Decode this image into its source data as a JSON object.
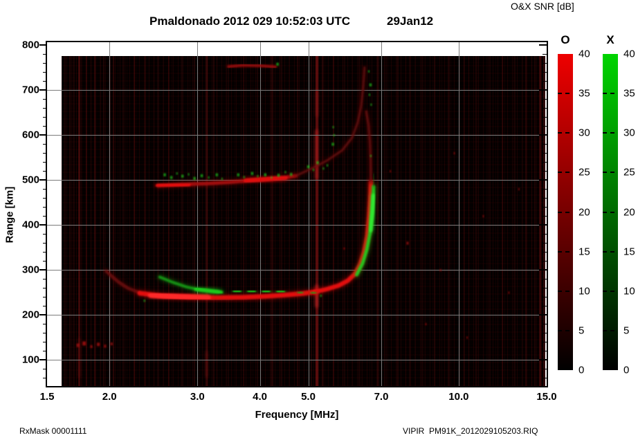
{
  "title": {
    "main": "Pmaldonado 2012 029 10:52:03 UTC",
    "date": "29Jan12"
  },
  "colorbar": {
    "header": "O&X SNR [dB]",
    "bars": [
      {
        "name": "O",
        "top_color": "#ee0000",
        "bottom_color": "#000000"
      },
      {
        "name": "X",
        "top_color": "#00d400",
        "bottom_color": "#000000"
      }
    ],
    "ticks": [
      "40",
      "35",
      "30",
      "25",
      "20",
      "15",
      "10",
      "5",
      "0"
    ],
    "min": 0,
    "max": 40,
    "units": "dB"
  },
  "axes": {
    "x": {
      "label": "Frequency [MHz]",
      "scale": "log",
      "min": 1.5,
      "max": 15,
      "tick_values": [
        1.5,
        2,
        3,
        4,
        5,
        7,
        10,
        15
      ],
      "tick_labels": [
        "1.5",
        "2.0",
        "3.0",
        "4.0",
        "5.0",
        "7.0",
        "10.0",
        "15.0"
      ]
    },
    "y": {
      "label": "Range [km]",
      "scale": "linear",
      "min": 42,
      "max": 806,
      "tick_values": [
        100,
        200,
        300,
        400,
        500,
        600,
        700,
        800
      ],
      "tick_labels": [
        "100",
        "200",
        "300",
        "400",
        "500",
        "600",
        "700",
        "800"
      ],
      "minor_step": 20
    }
  },
  "grid": {
    "x_lines": [
      2,
      3,
      4,
      5,
      7,
      10
    ],
    "y_lines": [
      100,
      200,
      300,
      400,
      500,
      600,
      700
    ],
    "color": "#7b7b7b"
  },
  "footer": {
    "left": "RxMask 00001111",
    "right": "VIPIR  PM91K_2012029105203.RIQ"
  },
  "chart_data": {
    "type": "heatmap",
    "description": "VIPIR ionogram: O-mode (red) and X-mode (green) echo SNR vs frequency and virtual range",
    "station": "Pmaldonado",
    "time_utc": "2012 029 10:52:03 UTC",
    "date": "29Jan12",
    "xlabel": "Frequency [MHz]",
    "ylabel": "Range [km]",
    "xlim": [
      1.5,
      15
    ],
    "ylim": [
      42,
      806
    ],
    "snr_scale_db": [
      0,
      40
    ],
    "data_extent": {
      "f_min": 1.6,
      "f_max": 14.95,
      "r_min": 42,
      "r_max": 775
    },
    "colors": {
      "O": {
        "dim": "#6e0808",
        "mid": "#a80d0d",
        "bright": "#e41111",
        "hot": "#ff2a2a"
      },
      "X": {
        "dim": "#0c6e0c",
        "mid": "#13a013",
        "bright": "#1ecd1e",
        "hot": "#33e833"
      }
    },
    "traces": [
      {
        "name": "o1-left-tail",
        "mode": "O",
        "lvl": "dim",
        "w": 4.5,
        "op": 0.85,
        "pts": [
          [
            1.97,
            297
          ],
          [
            2.02,
            286
          ],
          [
            2.09,
            272
          ],
          [
            2.18,
            259
          ],
          [
            2.3,
            249
          ]
        ]
      },
      {
        "name": "o1-flat",
        "mode": "O",
        "lvl": "bright",
        "w": 6.5,
        "op": 1,
        "pts": [
          [
            2.3,
            248
          ],
          [
            2.55,
            242
          ],
          [
            2.9,
            239
          ],
          [
            3.3,
            238
          ],
          [
            3.7,
            239
          ],
          [
            4.1,
            241
          ],
          [
            4.5,
            244
          ],
          [
            4.85,
            247
          ],
          [
            5.15,
            251
          ]
        ]
      },
      {
        "name": "o1-core",
        "mode": "O",
        "lvl": "hot",
        "w": 8,
        "op": 0.95,
        "pts": [
          [
            2.42,
            244
          ],
          [
            2.75,
            240
          ],
          [
            3.15,
            238
          ]
        ]
      },
      {
        "name": "o1-rise",
        "mode": "O",
        "lvl": "bright",
        "w": 6,
        "op": 1,
        "pts": [
          [
            5.15,
            251
          ],
          [
            5.45,
            257
          ],
          [
            5.75,
            265
          ],
          [
            6.0,
            276
          ],
          [
            6.2,
            291
          ],
          [
            6.35,
            312
          ],
          [
            6.47,
            340
          ],
          [
            6.56,
            375
          ],
          [
            6.62,
            420
          ],
          [
            6.655,
            462
          ],
          [
            6.67,
            495
          ]
        ]
      },
      {
        "name": "o1-asymptote",
        "mode": "O",
        "lvl": "dim",
        "w": 3.5,
        "op": 0.8,
        "pts": [
          [
            6.67,
            495
          ],
          [
            6.665,
            540
          ],
          [
            6.64,
            585
          ],
          [
            6.6,
            622
          ],
          [
            6.53,
            652
          ]
        ]
      },
      {
        "name": "o2-flat",
        "mode": "O",
        "lvl": "mid",
        "w": 5,
        "op": 0.95,
        "pts": [
          [
            2.5,
            487
          ],
          [
            2.8,
            490
          ],
          [
            3.15,
            492
          ],
          [
            3.5,
            495
          ],
          [
            3.85,
            499
          ],
          [
            4.2,
            502
          ],
          [
            4.55,
            506
          ],
          [
            4.72,
            509
          ]
        ]
      },
      {
        "name": "o2-left-bright",
        "mode": "O",
        "lvl": "bright",
        "w": 6,
        "op": 0.9,
        "pts": [
          [
            2.5,
            487
          ],
          [
            2.88,
            490
          ]
        ]
      },
      {
        "name": "o2-right-bright",
        "mode": "O",
        "lvl": "bright",
        "w": 6,
        "op": 0.9,
        "pts": [
          [
            3.75,
            498
          ],
          [
            4.5,
            505
          ]
        ]
      },
      {
        "name": "o2-cusp",
        "mode": "O",
        "lvl": "dim",
        "w": 3,
        "op": 0.8,
        "pts": [
          [
            4.72,
            509
          ],
          [
            5.05,
            524
          ],
          [
            5.45,
            543
          ],
          [
            5.85,
            566
          ],
          [
            6.12,
            594
          ],
          [
            6.28,
            628
          ],
          [
            6.38,
            664
          ],
          [
            6.44,
            706
          ],
          [
            6.48,
            750
          ]
        ]
      },
      {
        "name": "o3-top-streak",
        "mode": "O",
        "lvl": "mid",
        "w": 3.5,
        "op": 0.85,
        "pts": [
          [
            3.46,
            752
          ],
          [
            3.7,
            755
          ],
          [
            4.0,
            754
          ],
          [
            4.3,
            751
          ]
        ]
      },
      {
        "name": "x1-descent",
        "mode": "X",
        "lvl": "mid",
        "w": 4,
        "op": 0.9,
        "pts": [
          [
            2.52,
            284
          ],
          [
            2.68,
            272
          ],
          [
            2.85,
            262
          ],
          [
            3.05,
            255
          ],
          [
            3.3,
            251
          ]
        ]
      },
      {
        "name": "x1-bright",
        "mode": "X",
        "lvl": "bright",
        "w": 5,
        "op": 0.95,
        "pts": [
          [
            2.98,
            257
          ],
          [
            3.35,
            250
          ]
        ]
      },
      {
        "name": "x1-flat",
        "mode": "X",
        "lvl": "bright",
        "w": 3.5,
        "op": 0.9,
        "dash": "9 12",
        "pts": [
          [
            3.55,
            253
          ],
          [
            4.6,
            251
          ]
        ]
      },
      {
        "name": "x1-sparse",
        "mode": "X",
        "lvl": "mid",
        "w": 3,
        "op": 0.8,
        "dash": "5 14",
        "pts": [
          [
            4.78,
            250
          ],
          [
            5.2,
            248
          ]
        ]
      },
      {
        "name": "x1-rise",
        "mode": "X",
        "lvl": "bright",
        "w": 4.5,
        "op": 0.95,
        "pts": [
          [
            6.25,
            289
          ],
          [
            6.42,
            314
          ],
          [
            6.55,
            345
          ],
          [
            6.65,
            382
          ],
          [
            6.71,
            424
          ],
          [
            6.745,
            460
          ],
          [
            6.755,
            485
          ]
        ]
      },
      {
        "name": "x1-rise-hot",
        "mode": "X",
        "lvl": "hot",
        "w": 5.5,
        "op": 0.95,
        "pts": [
          [
            6.66,
            388
          ],
          [
            6.72,
            430
          ],
          [
            6.75,
            465
          ]
        ]
      },
      {
        "name": "x1-rise-tail",
        "mode": "X",
        "lvl": "dim",
        "w": 3,
        "op": 0.7,
        "pts": [
          [
            6.755,
            485
          ],
          [
            6.76,
            512
          ]
        ]
      }
    ],
    "speckles_x_mode": [
      [
        2.58,
        512,
        3
      ],
      [
        2.66,
        506,
        3
      ],
      [
        2.73,
        515,
        2
      ],
      [
        2.8,
        509,
        3
      ],
      [
        2.88,
        513,
        2
      ],
      [
        2.96,
        504,
        3
      ],
      [
        3.06,
        510,
        3
      ],
      [
        3.16,
        506,
        2
      ],
      [
        3.28,
        512,
        3
      ],
      [
        3.36,
        503,
        2
      ],
      [
        3.62,
        512,
        3
      ],
      [
        3.72,
        507,
        2
      ],
      [
        3.86,
        515,
        3
      ],
      [
        3.96,
        509,
        2
      ],
      [
        4.1,
        512,
        3
      ],
      [
        4.22,
        506,
        2
      ],
      [
        4.36,
        511,
        3
      ],
      [
        4.5,
        518,
        2
      ],
      [
        4.62,
        513,
        3
      ],
      [
        5.0,
        530,
        3
      ],
      [
        5.12,
        523,
        2
      ],
      [
        5.22,
        539,
        3
      ],
      [
        5.36,
        526,
        2
      ],
      [
        5.46,
        533,
        2
      ],
      [
        5.6,
        580,
        3
      ],
      [
        5.63,
        600,
        2
      ],
      [
        5.61,
        618,
        2
      ],
      [
        6.63,
        690,
        2
      ],
      [
        6.66,
        712,
        3
      ],
      [
        6.61,
        742,
        2
      ],
      [
        6.68,
        668,
        2
      ],
      [
        6.67,
        554,
        2
      ],
      [
        4.34,
        758,
        3
      ],
      [
        2.35,
        232,
        2
      ],
      [
        5.3,
        243,
        2
      ]
    ],
    "speckles_o_mode": [
      [
        1.73,
        133,
        4
      ],
      [
        1.78,
        137,
        5
      ],
      [
        1.84,
        130,
        3
      ],
      [
        1.9,
        135,
        4
      ],
      [
        1.96,
        131,
        3
      ],
      [
        2.02,
        136,
        3
      ],
      [
        7.9,
        360,
        3
      ],
      [
        9.2,
        300,
        2
      ],
      [
        11.2,
        420,
        2
      ],
      [
        8.6,
        180,
        2
      ],
      [
        12.6,
        250,
        2
      ],
      [
        10.4,
        150,
        2
      ],
      [
        13.2,
        480,
        2
      ],
      [
        7.3,
        520,
        2
      ],
      [
        9.8,
        560,
        2
      ],
      [
        5.9,
        348,
        2
      ]
    ],
    "rfi_columns": [
      [
        1.63,
        0.1,
        2
      ],
      [
        1.665,
        0.13,
        2
      ],
      [
        1.7,
        0.1,
        2
      ],
      [
        1.74,
        0.28,
        3
      ],
      [
        1.8,
        0.15,
        2
      ],
      [
        1.87,
        0.2,
        2
      ],
      [
        1.95,
        0.13,
        2
      ],
      [
        2.04,
        0.17,
        2
      ],
      [
        2.13,
        0.11,
        2
      ],
      [
        2.24,
        0.15,
        2
      ],
      [
        2.36,
        0.11,
        2
      ],
      [
        2.5,
        0.09,
        2
      ],
      [
        2.63,
        0.12,
        2
      ],
      [
        2.79,
        0.09,
        2
      ],
      [
        2.96,
        0.13,
        2
      ],
      [
        3.13,
        0.2,
        3
      ],
      [
        3.24,
        0.14,
        2
      ],
      [
        3.46,
        0.09,
        2
      ],
      [
        3.71,
        0.11,
        2
      ],
      [
        3.96,
        0.1,
        2
      ],
      [
        4.23,
        0.15,
        3
      ],
      [
        4.42,
        0.11,
        2
      ],
      [
        4.76,
        0.11,
        2
      ],
      [
        5.07,
        0.12,
        2
      ],
      [
        5.2,
        0.42,
        4
      ],
      [
        5.33,
        0.16,
        2
      ],
      [
        5.62,
        0.11,
        2
      ],
      [
        5.92,
        0.09,
        2
      ],
      [
        6.33,
        0.11,
        2
      ],
      [
        6.88,
        0.17,
        2
      ],
      [
        7.12,
        0.1,
        2
      ],
      [
        7.55,
        0.12,
        2
      ],
      [
        7.97,
        0.09,
        2
      ],
      [
        8.45,
        0.11,
        2
      ],
      [
        8.95,
        0.09,
        2
      ],
      [
        9.55,
        0.11,
        2
      ],
      [
        10.25,
        0.09,
        2
      ],
      [
        10.85,
        0.11,
        2
      ],
      [
        11.55,
        0.09,
        2
      ],
      [
        12.25,
        0.12,
        2
      ],
      [
        12.95,
        0.09,
        2
      ],
      [
        13.65,
        0.15,
        2
      ],
      [
        14.2,
        0.12,
        2
      ],
      [
        14.55,
        0.25,
        3
      ],
      [
        14.82,
        0.2,
        3
      ]
    ],
    "rfi_blobs": [
      {
        "f": 5.2,
        "r_lo": 500,
        "r_hi": 612,
        "w": 5,
        "color": "#c62222",
        "op": 0.55
      },
      {
        "f": 5.2,
        "r_lo": 215,
        "r_hi": 268,
        "w": 5,
        "color": "#d42a2a",
        "op": 0.6
      },
      {
        "f": 5.2,
        "r_lo": 640,
        "r_hi": 700,
        "w": 4,
        "color": "#a81c1c",
        "op": 0.4
      },
      {
        "f": 3.13,
        "r_lo": 60,
        "r_hi": 120,
        "w": 3,
        "color": "#8c1414",
        "op": 0.5
      },
      {
        "f": 1.74,
        "r_lo": 60,
        "r_hi": 150,
        "w": 3,
        "color": "#7a1010",
        "op": 0.45
      }
    ]
  }
}
